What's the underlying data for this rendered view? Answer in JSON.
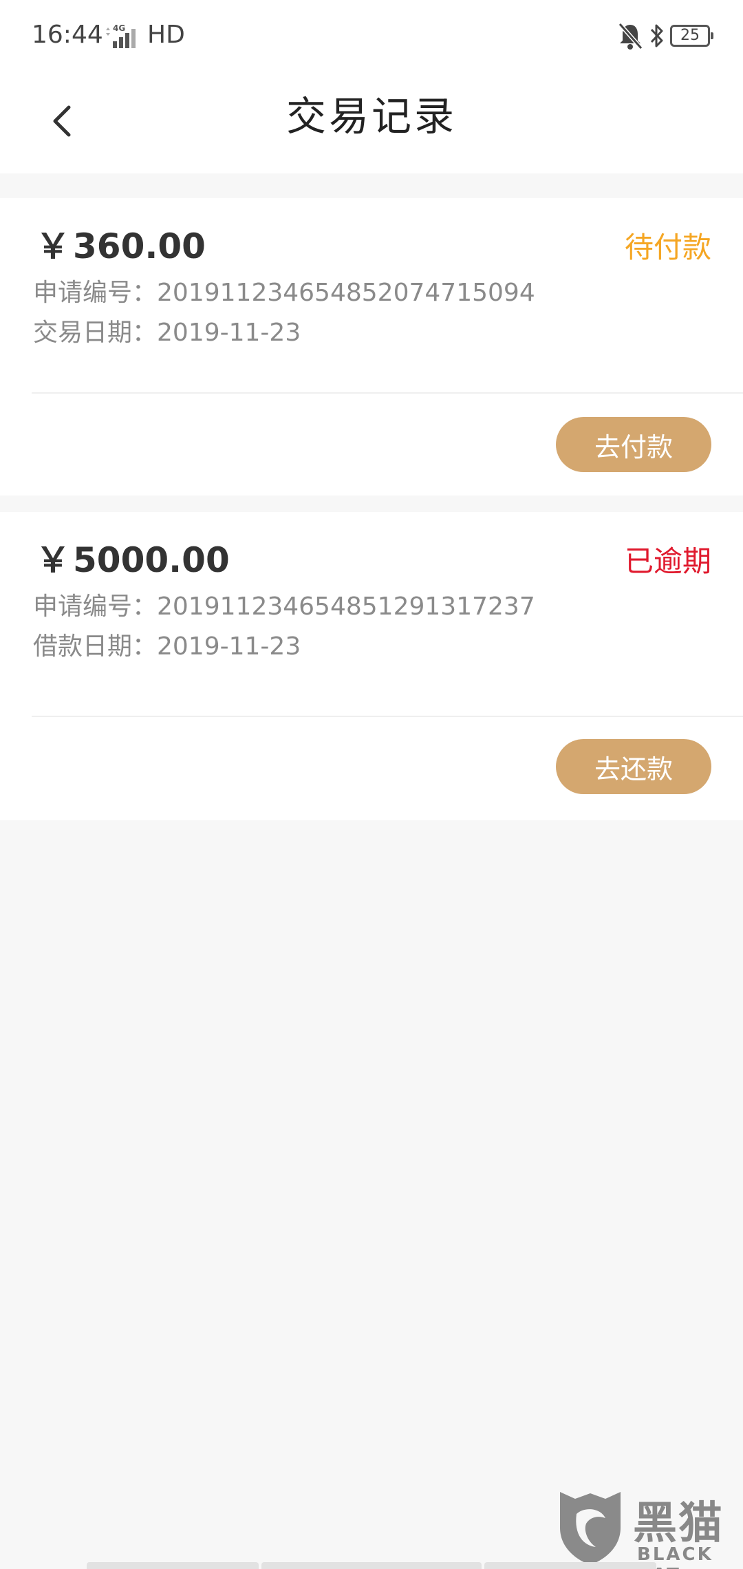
{
  "status_bar": {
    "time": "16:44",
    "network": "4G",
    "hd": "HD",
    "battery": "25"
  },
  "header": {
    "title": "交易记录"
  },
  "records": [
    {
      "currency": "￥",
      "amount": "360.00",
      "status": "待付款",
      "status_color": "#f5a623",
      "id_label": "申请编号：",
      "id_value": "20191123465485207471509​4",
      "date_label": "交易日期：",
      "date_value": "2019-11-23",
      "action_label": "去付款"
    },
    {
      "currency": "￥",
      "amount": "5000.00",
      "status": "已逾期",
      "status_color": "#e0192d",
      "id_label": "申请编号：",
      "id_value": "201911234654851291317237",
      "date_label": "借款日期：",
      "date_value": "2019-11-23",
      "action_label": "去还款"
    }
  ],
  "watermark": {
    "text": "黑猫",
    "sub": "BLACK CAT"
  },
  "colors": {
    "accent_button": "#d4a76f",
    "pending": "#f5a623",
    "overdue": "#e0192d"
  }
}
